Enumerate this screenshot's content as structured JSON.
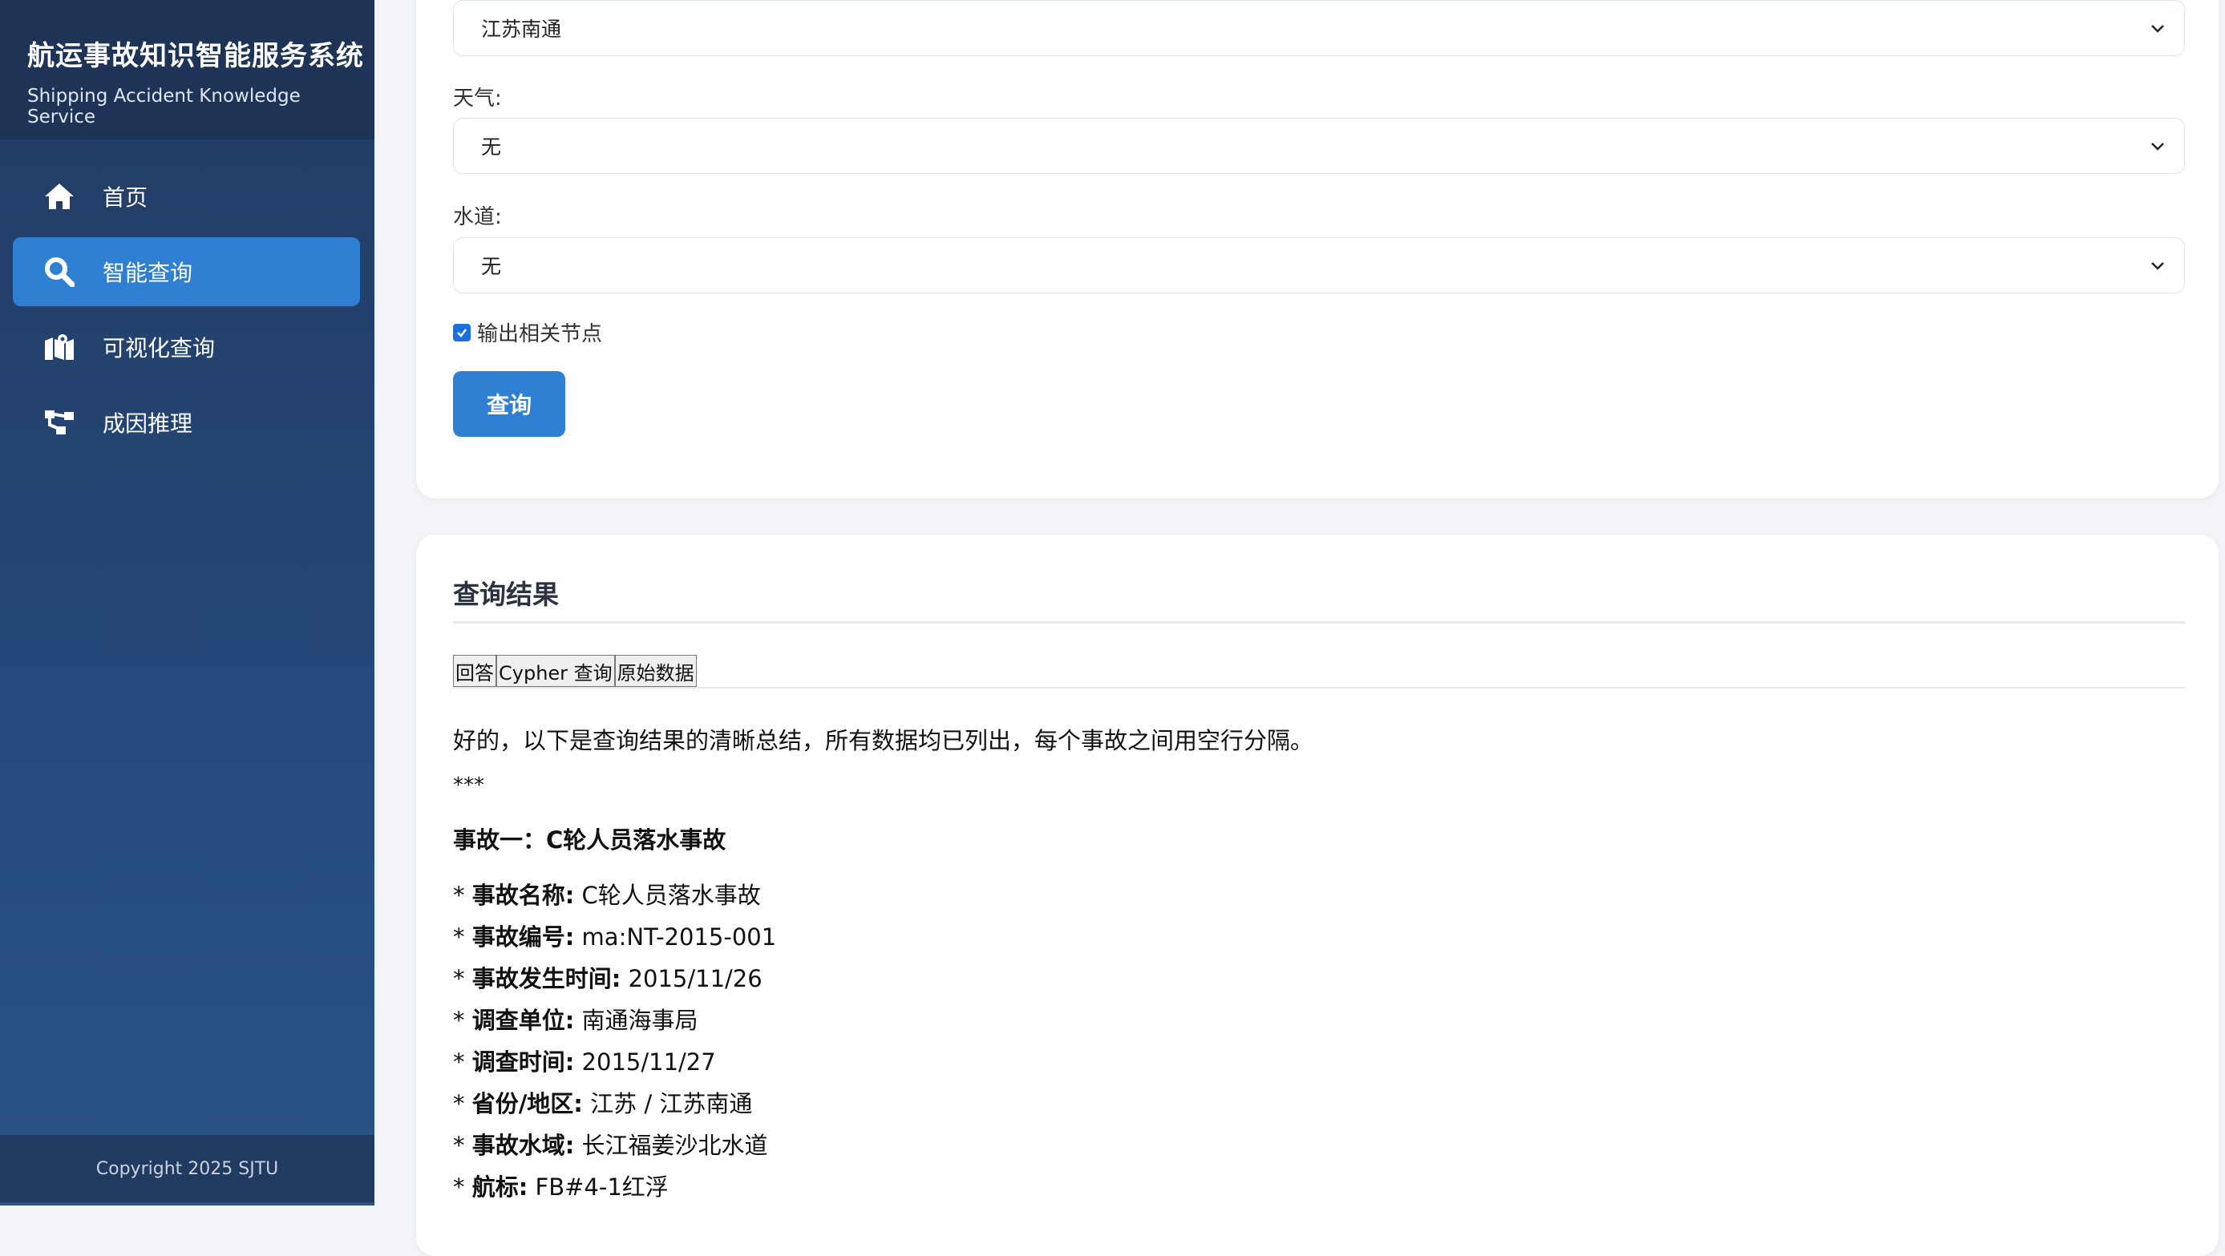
{
  "sidebar": {
    "title": "航运事故知识智能服务系统",
    "subtitle": "Shipping Accident Knowledge Service",
    "items": [
      {
        "label": "首页",
        "icon": "home-icon"
      },
      {
        "label": "智能查询",
        "icon": "search-icon"
      },
      {
        "label": "可视化查询",
        "icon": "map-icon"
      },
      {
        "label": "成因推理",
        "icon": "sitemap-icon"
      }
    ],
    "footer": "Copyright 2025 SJTU"
  },
  "form": {
    "region_value": "江苏南通",
    "weather_label": "天气:",
    "weather_value": "无",
    "waterway_label": "水道:",
    "waterway_value": "无",
    "output_nodes_label": "输出相关节点",
    "query_button": "查询"
  },
  "result": {
    "title": "查询结果",
    "tabs": [
      "回答",
      "Cypher 查询",
      "原始数据"
    ],
    "intro": "好的，以下是查询结果的清晰总结，所有数据均已列出，每个事故之间用空行分隔。",
    "separator": "***",
    "accident_heading": "事故一：C轮人员落水事故",
    "fields": [
      {
        "key": "事故名称:",
        "value": "C轮人员落水事故"
      },
      {
        "key": "事故编号:",
        "value": "ma:NT-2015-001"
      },
      {
        "key": "事故发生时间:",
        "value": "2015/11/26"
      },
      {
        "key": "调查单位:",
        "value": "南通海事局"
      },
      {
        "key": "调查时间:",
        "value": "2015/11/27"
      },
      {
        "key": "省份/地区:",
        "value": "江苏 / 江苏南通"
      },
      {
        "key": "事故水域:",
        "value": "长江福姜沙北水道"
      },
      {
        "key": "航标:",
        "value": "FB#4-1红浮"
      }
    ]
  },
  "colors": {
    "accent": "#2f7fd2",
    "sidebar": "#254a7c"
  }
}
